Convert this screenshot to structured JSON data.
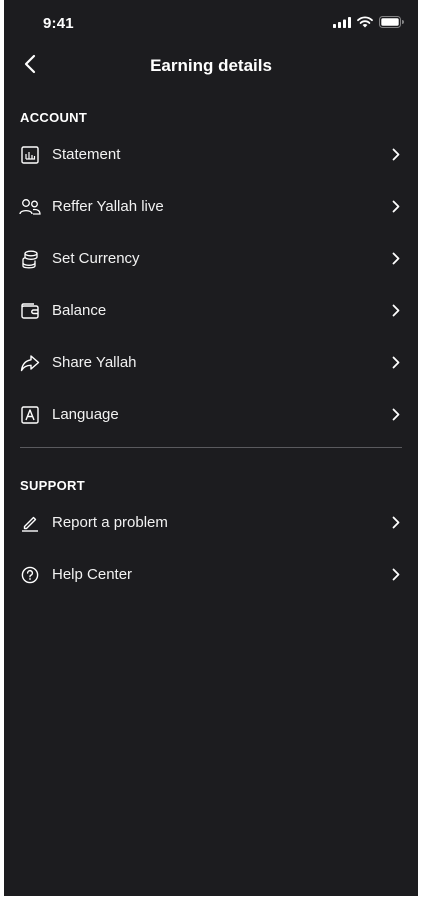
{
  "status_bar": {
    "time": "9:41"
  },
  "header": {
    "title": "Earning details"
  },
  "account": {
    "label": "ACCOUNT",
    "items": [
      {
        "label": "Statement",
        "icon": "statement-icon"
      },
      {
        "label": "Reffer Yallah live",
        "icon": "users-icon"
      },
      {
        "label": "Set Currency",
        "icon": "coins-icon"
      },
      {
        "label": "Balance",
        "icon": "wallet-icon"
      },
      {
        "label": "Share Yallah",
        "icon": "share-icon"
      },
      {
        "label": "Language",
        "icon": "language-icon"
      }
    ]
  },
  "support": {
    "label": "SUPPORT",
    "items": [
      {
        "label": "Report a problem",
        "icon": "pencil-icon"
      },
      {
        "label": "Help Center",
        "icon": "help-icon"
      }
    ]
  },
  "colors": {
    "background": "#1c1c1f",
    "text": "#ffffff",
    "divider": "#5a5a5e"
  }
}
